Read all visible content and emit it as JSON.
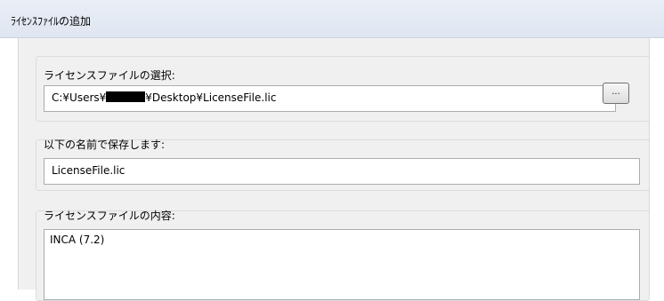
{
  "dialog": {
    "title": "ﾗｲｾﾝｽﾌｧｲﾙの追加"
  },
  "license_file_select": {
    "label": "ライセンスファイルの選択:",
    "path_prefix": "C:¥Users¥",
    "path_suffix": "¥Desktop¥LicenseFile.lic",
    "browse_label": "..."
  },
  "save_as": {
    "label": "以下の名前で保存します:",
    "value": "LicenseFile.lic"
  },
  "contents": {
    "label": "ライセンスファイルの内容:",
    "text": "INCA (7.2)"
  }
}
